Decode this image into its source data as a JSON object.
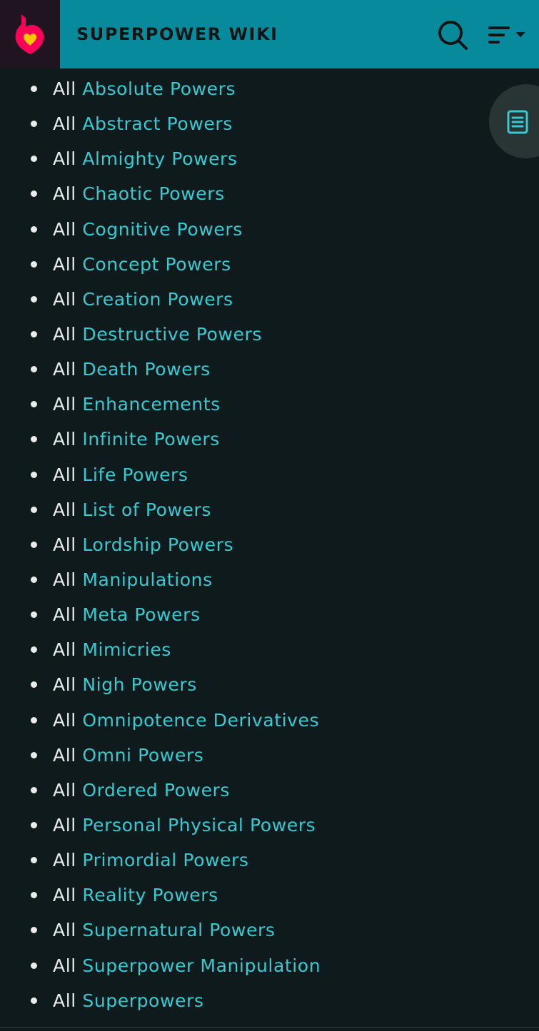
{
  "header": {
    "site_title": "SUPERPOWER WIKI",
    "logo_icon": "fandom-heart-flame-icon",
    "search_icon": "search-icon",
    "menu_icon": "menu-dropdown-icon",
    "background_color": "#078b9c"
  },
  "toc_button": {
    "icon": "table-of-contents-icon"
  },
  "colors": {
    "page_background": "#0e1a1b",
    "link": "#38c9d1",
    "text": "#e8ecec"
  },
  "list": [
    {
      "prefix": "All ",
      "link": "Absolute Powers"
    },
    {
      "prefix": "All ",
      "link": "Abstract Powers"
    },
    {
      "prefix": "All ",
      "link": "Almighty Powers"
    },
    {
      "prefix": "All ",
      "link": "Chaotic Powers"
    },
    {
      "prefix": "All ",
      "link": "Cognitive Powers"
    },
    {
      "prefix": "All ",
      "link": "Concept Powers"
    },
    {
      "prefix": "All ",
      "link": "Creation Powers"
    },
    {
      "prefix": "All ",
      "link": "Destructive Powers"
    },
    {
      "prefix": "All ",
      "link": "Death Powers"
    },
    {
      "prefix": "All ",
      "link": "Enhancements"
    },
    {
      "prefix": "All ",
      "link": "Infinite Powers"
    },
    {
      "prefix": "All ",
      "link": "Life Powers"
    },
    {
      "prefix": "All ",
      "link": "List of Powers"
    },
    {
      "prefix": "All ",
      "link": "Lordship Powers"
    },
    {
      "prefix": "All ",
      "link": "Manipulations"
    },
    {
      "prefix": "All ",
      "link": "Meta Powers"
    },
    {
      "prefix": "All ",
      "link": "Mimicries"
    },
    {
      "prefix": "All ",
      "link": "Nigh Powers"
    },
    {
      "prefix": "All ",
      "link": "Omnipotence Derivatives"
    },
    {
      "prefix": "All ",
      "link": "Omni Powers"
    },
    {
      "prefix": "All ",
      "link": "Ordered Powers"
    },
    {
      "prefix": "All ",
      "link": "Personal Physical Powers"
    },
    {
      "prefix": "All ",
      "link": "Primordial Powers"
    },
    {
      "prefix": "All ",
      "link": "Reality Powers"
    },
    {
      "prefix": "All ",
      "link": "Supernatural Powers"
    },
    {
      "prefix": "All ",
      "link": "Superpower Manipulation"
    },
    {
      "prefix": "All ",
      "link": "Superpowers"
    }
  ]
}
